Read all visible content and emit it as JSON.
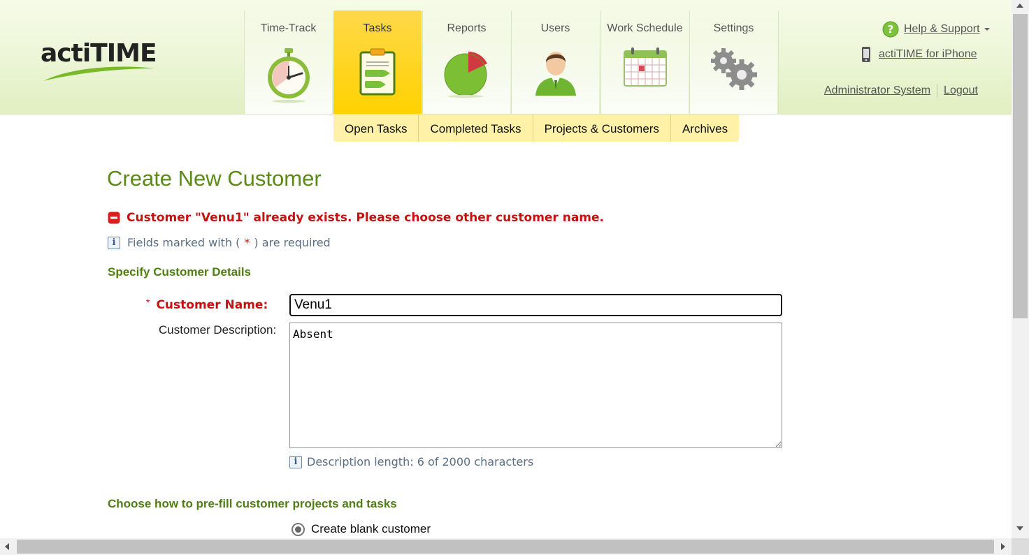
{
  "app": {
    "logo_text": "actiTIME"
  },
  "nav": {
    "tabs": [
      {
        "label": "Time-Track",
        "icon": "stopwatch-icon",
        "active": false
      },
      {
        "label": "Tasks",
        "icon": "tasks-clipboard-icon",
        "active": true
      },
      {
        "label": "Reports",
        "icon": "pie-chart-icon",
        "active": false
      },
      {
        "label": "Users",
        "icon": "user-icon",
        "active": false
      },
      {
        "label": "Work Schedule",
        "icon": "calendar-icon",
        "active": false
      },
      {
        "label": "Settings",
        "icon": "gears-icon",
        "active": false
      }
    ],
    "subtabs": [
      "Open Tasks",
      "Completed Tasks",
      "Projects & Customers",
      "Archives"
    ]
  },
  "header_links": {
    "help": "Help & Support",
    "iphone": "actiTIME for iPhone",
    "user": "Administrator System",
    "logout": "Logout"
  },
  "page": {
    "title": "Create New Customer",
    "error": "Customer \"Venu1\" already exists. Please choose other customer name.",
    "required_prefix": "Fields marked with (",
    "required_star": "*",
    "required_suffix": ") are required",
    "section_details": "Specify Customer Details",
    "name_star": "*",
    "name_label": "Customer Name:",
    "name_value": "Venu1",
    "desc_label": "Customer Description:",
    "desc_value": "Absent",
    "desc_length": "Description length: 6 of 2000 characters",
    "section_prefill": "Choose how to pre-fill customer projects and tasks",
    "radio_blank": "Create blank customer"
  },
  "colors": {
    "accent_green": "#5b8a17",
    "error_red": "#c91010",
    "active_tab": "#ffd200",
    "subnav_bg": "#fff2a8"
  }
}
